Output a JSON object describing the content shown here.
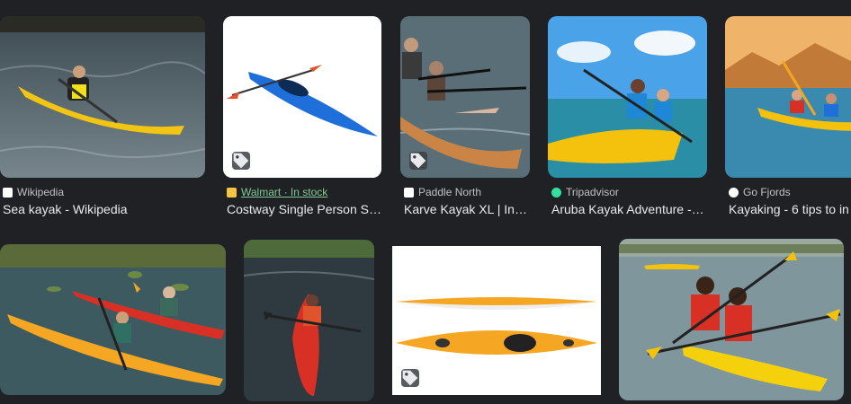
{
  "results": [
    {
      "source": "Wikipedia",
      "title": "Sea kayak - Wikipedia",
      "icon": "wikipedia-favicon"
    },
    {
      "source": "Walmart",
      "stock": "In stock",
      "title": "Costway Single Person S…",
      "icon": "walmart-favicon",
      "tag_icon": "product-tag-icon"
    },
    {
      "source": "Paddle North",
      "title": "Karve Kayak XL | Inf…",
      "icon": "paddle-north-favicon",
      "tag_icon": "product-tag-icon"
    },
    {
      "source": "Tripadvisor",
      "title": "Aruba Kayak Adventure -…",
      "icon": "tripadvisor-favicon"
    },
    {
      "source": "Go Fjords",
      "title": "Kayaking - 6 tips to in",
      "icon": "go-fjords-favicon"
    }
  ],
  "colors": {
    "background": "#202124",
    "text": "#e8eaed",
    "source_text": "#bdc1c6",
    "in_stock": "#81c995",
    "kayak_yellow": "#f4c20d",
    "kayak_blue": "#1e6fd9",
    "kayak_red": "#d93025",
    "kayak_orange": "#f5a623"
  }
}
